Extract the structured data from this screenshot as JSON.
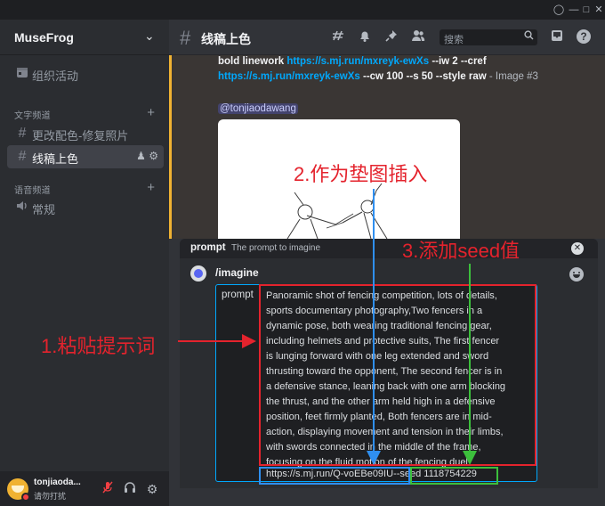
{
  "server": {
    "name": "MuseFrog"
  },
  "sidebar": {
    "events_label": "组织活动",
    "text_category": "文字频道",
    "text_channels": [
      {
        "label": "更改配色-修复照片"
      },
      {
        "label": "线稿上色"
      }
    ],
    "voice_category": "语音频道",
    "voice_channels": [
      {
        "label": "常规"
      }
    ]
  },
  "user": {
    "name": "tonjiaoda...",
    "status": "请勿打扰"
  },
  "channel": {
    "name": "线稿上色"
  },
  "search": {
    "placeholder": "搜索"
  },
  "message": {
    "line1_bold": "bold linework",
    "line1_link": "https://s.mj.run/mxreyk-ewXs",
    "line1_tail": "--iw 2 --cref",
    "line2_link": "https://s.mj.run/mxreyk-ewXs",
    "line2_tail": "--cw 100 --s 50 --style raw",
    "line2_suffix": "- Image #3",
    "mention": "@tonjiaodawang"
  },
  "prompt_popup": {
    "title": "prompt",
    "description": "The prompt to imagine",
    "command": "/imagine",
    "option_name": "prompt",
    "lines": [
      "Panoramic shot of fencing competition, lots of details,",
      "sports documentary photography,Two fencers in a",
      "dynamic pose, both wearing traditional fencing gear,",
      "including helmets and protective suits, The first fencer",
      "is lunging forward with one leg extended and sword",
      "thrusting toward the opponent, The second fencer is in",
      "a defensive stance, leaning back with one arm blocking",
      "the thrust, and the other arm held high in a defensive",
      "position, feet firmly planted, Both fencers are in mid-",
      "action, displaying movement and tension in their limbs,",
      "with swords connected in the middle of the frame,",
      "focusing on the fluid motion of the fencing duel"
    ],
    "image_url": "https://s.mj.run/Q-voEBe09IU",
    "seed": "--seed 1118754229"
  },
  "annotations": {
    "paste_prompt": "1.粘贴提示词",
    "insert_image": "2.作为垫图插入",
    "add_seed": "3.添加seed值",
    "colors": {
      "red": "#e4232d",
      "blue": "#2f8ff0",
      "green": "#3cbf3c"
    }
  }
}
